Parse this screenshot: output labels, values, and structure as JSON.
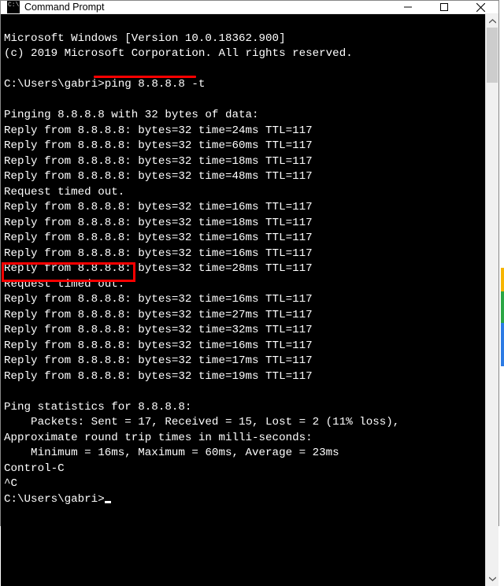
{
  "window": {
    "title": "Command Prompt"
  },
  "terminal": {
    "line01": "Microsoft Windows [Version 10.0.18362.900]",
    "line02": "(c) 2019 Microsoft Corporation. All rights reserved.",
    "line03": "",
    "prompt1_path": "C:\\Users\\gabri>",
    "prompt1_cmd": "ping 8.8.8.8 -t",
    "line05": "",
    "line06": "Pinging 8.8.8.8 with 32 bytes of data:",
    "line07": "Reply from 8.8.8.8: bytes=32 time=24ms TTL=117",
    "line08": "Reply from 8.8.8.8: bytes=32 time=60ms TTL=117",
    "line09": "Reply from 8.8.8.8: bytes=32 time=18ms TTL=117",
    "line10": "Reply from 8.8.8.8: bytes=32 time=48ms TTL=117",
    "line11": "Request timed out.",
    "line12": "Reply from 8.8.8.8: bytes=32 time=16ms TTL=117",
    "line13": "Reply from 8.8.8.8: bytes=32 time=18ms TTL=117",
    "line14": "Reply from 8.8.8.8: bytes=32 time=16ms TTL=117",
    "line15": "Reply from 8.8.8.8: bytes=32 time=16ms TTL=117",
    "line16": "Reply from 8.8.8.8: bytes=32 time=28ms TTL=117",
    "line17": "Request timed out.",
    "line18": "Reply from 8.8.8.8: bytes=32 time=16ms TTL=117",
    "line19": "Reply from 8.8.8.8: bytes=32 time=27ms TTL=117",
    "line20": "Reply from 8.8.8.8: bytes=32 time=32ms TTL=117",
    "line21": "Reply from 8.8.8.8: bytes=32 time=16ms TTL=117",
    "line22": "Reply from 8.8.8.8: bytes=32 time=17ms TTL=117",
    "line23": "Reply from 8.8.8.8: bytes=32 time=19ms TTL=117",
    "line24": "",
    "line25": "Ping statistics for 8.8.8.8:",
    "line26": "    Packets: Sent = 17, Received = 15, Lost = 2 (11% loss),",
    "line27": "Approximate round trip times in milli-seconds:",
    "line28": "    Minimum = 16ms, Maximum = 60ms, Average = 23ms",
    "line29": "Control-C",
    "line30": "^C",
    "prompt2_path": "C:\\Users\\gabri>"
  },
  "annotations": {
    "underline_color": "#ff0000",
    "box_color": "#ff0000"
  }
}
